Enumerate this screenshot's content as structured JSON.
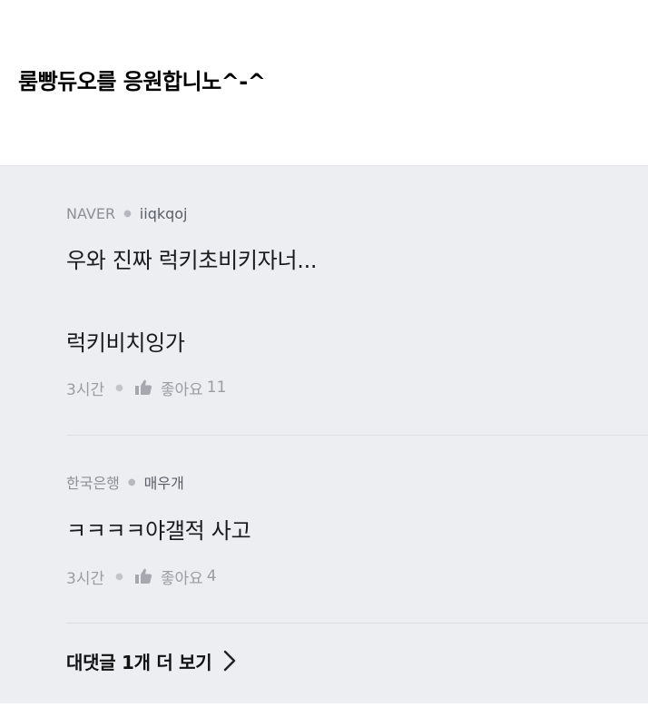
{
  "post": {
    "title": "룸빵듀오를 응원합니노^-^"
  },
  "comments": [
    {
      "source": "NAVER",
      "author": "iiqkqoj",
      "lines": [
        "우와 진짜 럭키초비키자너...",
        "럭키비치잉가"
      ],
      "time": "3시간",
      "like_label": "좋아요",
      "like_count": "11"
    },
    {
      "source": "한국은행",
      "author": "매우개",
      "lines": [
        "ㅋㅋㅋㅋ야갤적 사고"
      ],
      "time": "3시간",
      "like_label": "좋아요",
      "like_count": "4"
    }
  ],
  "more_replies": {
    "label": "대댓글 1개 더 보기"
  },
  "colors": {
    "panel_bg": "#eceef2",
    "meta_text": "#8b8f96",
    "icon": "#a5a8ae"
  }
}
